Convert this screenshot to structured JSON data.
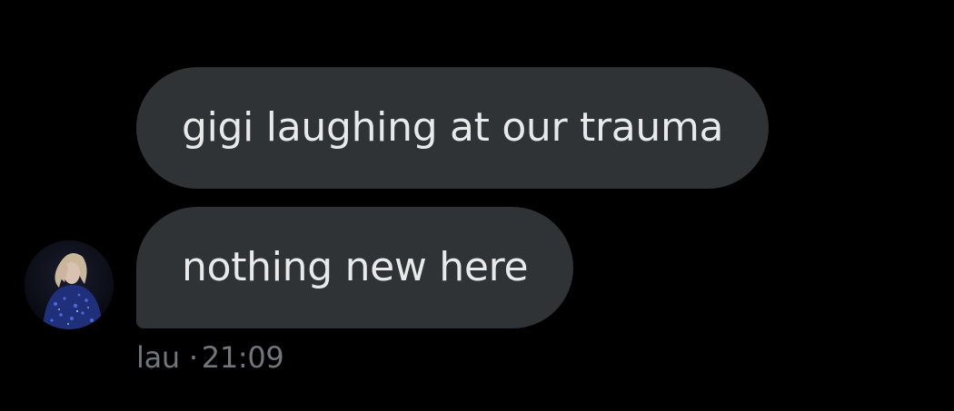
{
  "conversation": {
    "messages": [
      {
        "text": "gigi laughing at our trauma"
      },
      {
        "text": "nothing new here"
      }
    ],
    "sender": {
      "name": "lau",
      "separator": "·",
      "time": "21:09"
    }
  },
  "colors": {
    "background": "#000000",
    "bubble": "#2f3336",
    "bubble_text": "#e7e9ea",
    "meta_text": "#71767b"
  },
  "icons": {
    "avatar": "profile-photo"
  }
}
